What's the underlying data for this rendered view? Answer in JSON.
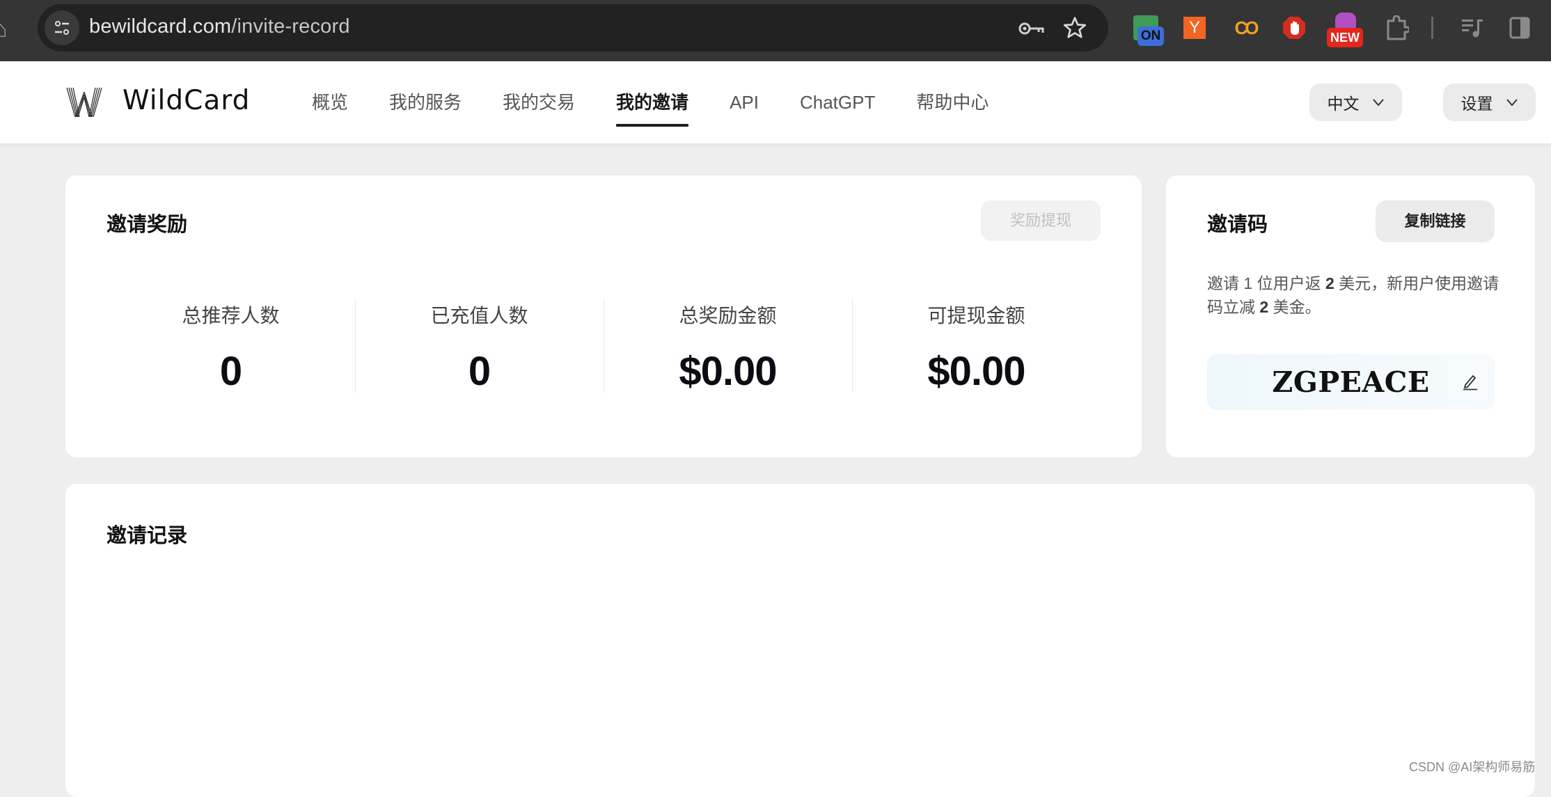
{
  "browser": {
    "url_host": "bewildcard.com",
    "url_path": "/invite-record",
    "extensions": [
      {
        "name": "on-toggle-extension",
        "badge": "ON"
      },
      {
        "name": "ycombinator-extension",
        "label": "Y"
      },
      {
        "name": "colab-extension",
        "label": "CO"
      },
      {
        "name": "adblock-extension"
      },
      {
        "name": "new-extension",
        "badge": "NEW"
      }
    ]
  },
  "header": {
    "brand": "WildCard",
    "nav": [
      {
        "label": "概览",
        "active": false
      },
      {
        "label": "我的服务",
        "active": false
      },
      {
        "label": "我的交易",
        "active": false
      },
      {
        "label": "我的邀请",
        "active": true
      },
      {
        "label": "API",
        "active": false
      },
      {
        "label": "ChatGPT",
        "active": false
      },
      {
        "label": "帮助中心",
        "active": false
      }
    ],
    "language_label": "中文",
    "settings_label": "设置"
  },
  "reward": {
    "title": "邀请奖励",
    "withdraw_label": "奖励提现",
    "stats": [
      {
        "label": "总推荐人数",
        "value": "0"
      },
      {
        "label": "已充值人数",
        "value": "0"
      },
      {
        "label": "总奖励金额",
        "value": "$0.00"
      },
      {
        "label": "可提现金额",
        "value": "$0.00"
      }
    ]
  },
  "invite_code": {
    "title": "邀请码",
    "copy_label": "复制链接",
    "desc_part1": "邀请 1 位用户返 ",
    "desc_bold1": "2",
    "desc_part2": " 美元，新用户使用邀请码立减 ",
    "desc_bold2": "2",
    "desc_part3": " 美金。",
    "code": "ZGPEACE"
  },
  "records": {
    "title": "邀请记录"
  },
  "watermark": "CSDN @AI架构师易筋",
  "colors": {
    "active_underline": "#1e1e1e",
    "page_bg": "#eeeeee",
    "card_bg": "#ffffff",
    "button_bg": "#ebebeb",
    "disabled_text": "#c0c0c0"
  }
}
